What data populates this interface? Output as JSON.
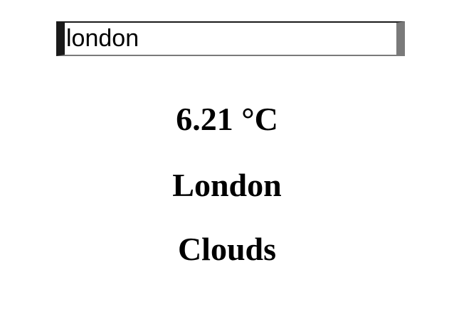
{
  "search": {
    "value": "london"
  },
  "weather": {
    "temperature": "6.21 °C",
    "city": "London",
    "condition": "Clouds"
  }
}
